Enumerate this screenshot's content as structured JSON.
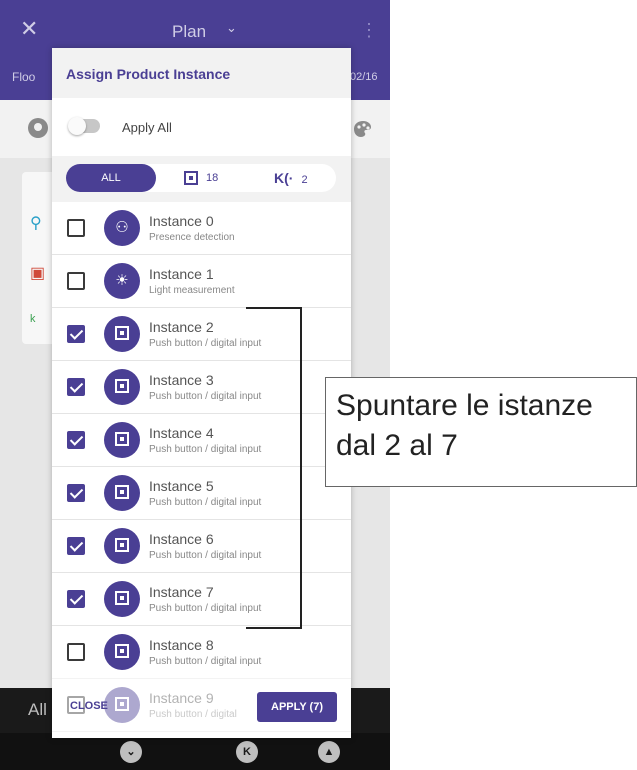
{
  "app": {
    "title": "Plan",
    "floor_label": "Floo",
    "date_text": "02/16",
    "bottom_label": "All"
  },
  "dialog": {
    "title": "Assign Product Instance",
    "apply_all_label": "Apply All",
    "apply_all_on": false,
    "filters": {
      "all_label": "ALL",
      "input_count": "18",
      "wireless_count": "2"
    },
    "instances": [
      {
        "name": "Instance 0",
        "type": "Presence detection",
        "checked": false,
        "icon": "presence-sensor-icon"
      },
      {
        "name": "Instance 1",
        "type": "Light measurement",
        "checked": false,
        "icon": "light-sensor-icon"
      },
      {
        "name": "Instance 2",
        "type": "Push button / digital input",
        "checked": true,
        "icon": "push-button-icon"
      },
      {
        "name": "Instance 3",
        "type": "Push button / digital input",
        "checked": true,
        "icon": "push-button-icon"
      },
      {
        "name": "Instance 4",
        "type": "Push button / digital input",
        "checked": true,
        "icon": "push-button-icon"
      },
      {
        "name": "Instance 5",
        "type": "Push button / digital input",
        "checked": true,
        "icon": "push-button-icon"
      },
      {
        "name": "Instance 6",
        "type": "Push button / digital input",
        "checked": true,
        "icon": "push-button-icon"
      },
      {
        "name": "Instance 7",
        "type": "Push button / digital input",
        "checked": true,
        "icon": "push-button-icon"
      },
      {
        "name": "Instance 8",
        "type": "Push button / digital input",
        "checked": false,
        "icon": "push-button-icon"
      },
      {
        "name": "Instance 9",
        "type": "Push button / digital",
        "checked": false,
        "icon": "push-button-icon"
      }
    ],
    "close_label": "CLOSE",
    "apply_label": "APPLY (7)"
  },
  "annotation": {
    "line1": "Spuntare le istanze",
    "line2": "dal 2 al 7"
  },
  "colors": {
    "brand": "#4a3f94",
    "dark_bar": "#1a1a1a"
  }
}
